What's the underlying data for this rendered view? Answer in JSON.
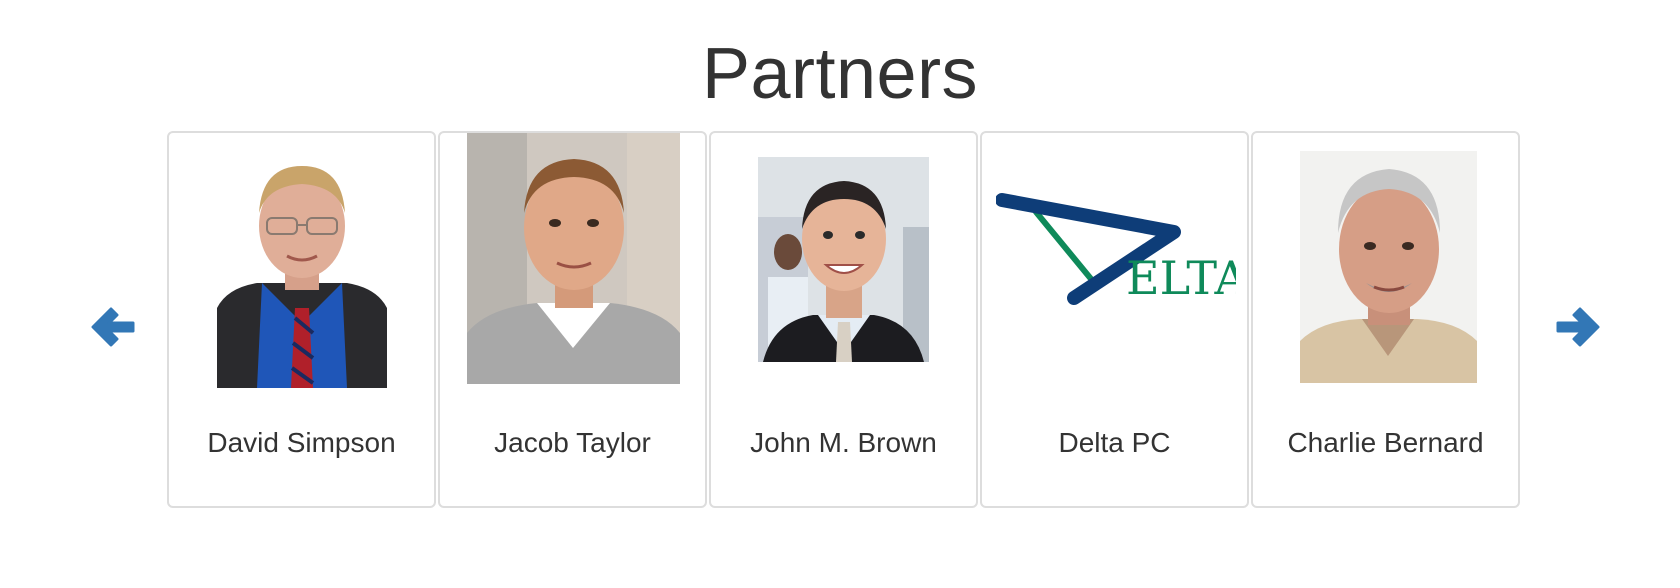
{
  "heading": "Partners",
  "nav": {
    "prev_icon": "arrow-left-icon",
    "next_icon": "arrow-right-icon",
    "accent_color": "#3277b6"
  },
  "partners": [
    {
      "name": "David Simpson",
      "photo": "portrait-older-man-glasses-suit"
    },
    {
      "name": "Jacob Taylor",
      "photo": "portrait-young-man-gray-sweater"
    },
    {
      "name": "John M. Brown",
      "photo": "portrait-smiling-man-suit-office"
    },
    {
      "name": "Delta PC",
      "photo": "delta-logo",
      "logo_text": "ELTA"
    },
    {
      "name": "Charlie Bernard",
      "photo": "portrait-gray-haired-man"
    }
  ]
}
